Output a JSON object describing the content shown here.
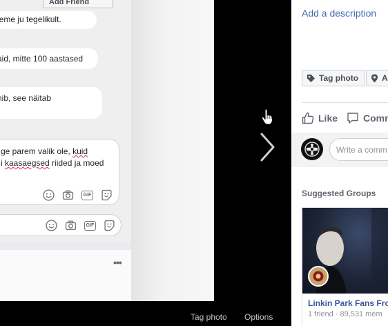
{
  "chat": {
    "add_friend_label": "Add Friend",
    "messages": [
      "leme ju tegelikult.",
      "aid, mitte 100 aastased",
      "nib, see näitab"
    ],
    "reply_lines": {
      "line1_a": "ge parem valik ole, ",
      "line1_b": "kuid",
      "line2_a": "i ",
      "line2_b": "kaasaegsed",
      "line2_c": " riided ja moed"
    },
    "more_label": "•••"
  },
  "theater": {
    "tag_photo_label": "Tag photo",
    "options_label": "Options"
  },
  "sidebar": {
    "add_description": "Add a description",
    "tag_photo_button": "Tag photo",
    "add_location_button": "A",
    "like_label": "Like",
    "comment_label": "Comm",
    "comment_placeholder": "Write a comm",
    "suggested_groups_title": "Suggested Groups",
    "group": {
      "name": "Linkin Park Fans Fron",
      "meta": "1 friend · 89,531 mem"
    }
  },
  "colors": {
    "link_blue": "#4267b2",
    "group_name_blue": "#385898",
    "theater_bg": "#000000"
  },
  "icons": [
    "tag-icon",
    "location-pin-icon",
    "thumbs-up-icon",
    "comment-bubble-icon",
    "smiley-icon",
    "camera-icon",
    "gif-icon",
    "sticker-icon",
    "chevron-right-icon",
    "hand-cursor-icon"
  ]
}
